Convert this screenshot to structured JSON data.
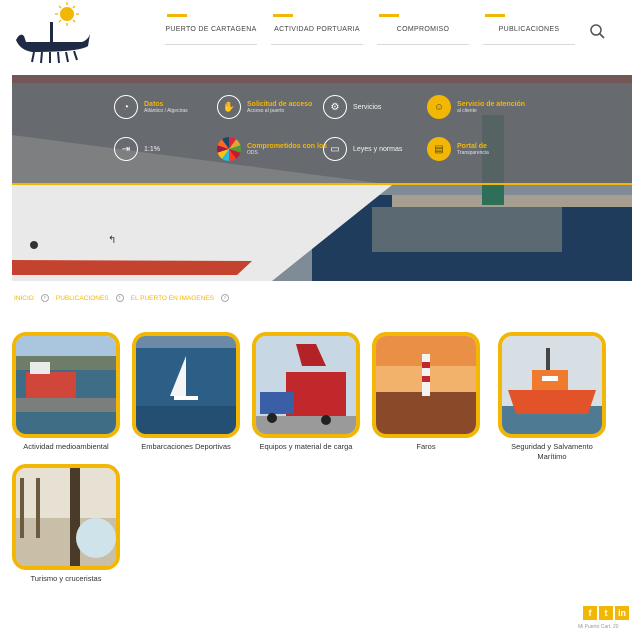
{
  "header": {
    "nav": [
      {
        "label": "PUERTO DE CARTAGENA"
      },
      {
        "label": "ACTIVIDAD PORTUARIA"
      },
      {
        "label": "COMPROMISO"
      },
      {
        "label": "PUBLICACIONES"
      }
    ]
  },
  "hero": {
    "services": [
      {
        "title": "Datos",
        "subtitle": "Atlántico / Algeciras",
        "icon": "gauge-icon"
      },
      {
        "title": "Solicitud de acceso",
        "subtitle": "Acceso al puerto",
        "icon": "hand-icon"
      },
      {
        "title": "Servicios",
        "subtitle": "",
        "icon": "gear-icon"
      },
      {
        "title": "Servicio de atención",
        "subtitle": "al cliente",
        "icon": "person-icon"
      },
      {
        "title": "1:1%",
        "subtitle": "",
        "icon": "login-icon"
      },
      {
        "title": "Comprometidos con los",
        "subtitle": "ODS",
        "icon": "sdg-wheel-icon"
      },
      {
        "title": "Leyes y normas",
        "subtitle": "",
        "icon": "document-icon"
      },
      {
        "title": "Portal de",
        "subtitle": "Transparencia",
        "icon": "portal-icon"
      }
    ]
  },
  "breadcrumb": {
    "items": [
      "INICIO",
      "PUBLICACIONES",
      "EL PUERTO EN IMAGENES"
    ]
  },
  "gallery": {
    "items": [
      {
        "label": "Actividad medioambiental"
      },
      {
        "label": "Embarcaciones Deportivas"
      },
      {
        "label": "Equipos y material de carga"
      },
      {
        "label": "Faros"
      },
      {
        "label": "Seguridad y Salvamento Marítimo"
      },
      {
        "label": "Turismo y cruceristas"
      }
    ]
  },
  "footer": {
    "social": [
      "f",
      "t",
      "in"
    ],
    "note": "Mi Puerto Cart. 20"
  },
  "colors": {
    "accent": "#f2b705",
    "panel": "#606264"
  }
}
